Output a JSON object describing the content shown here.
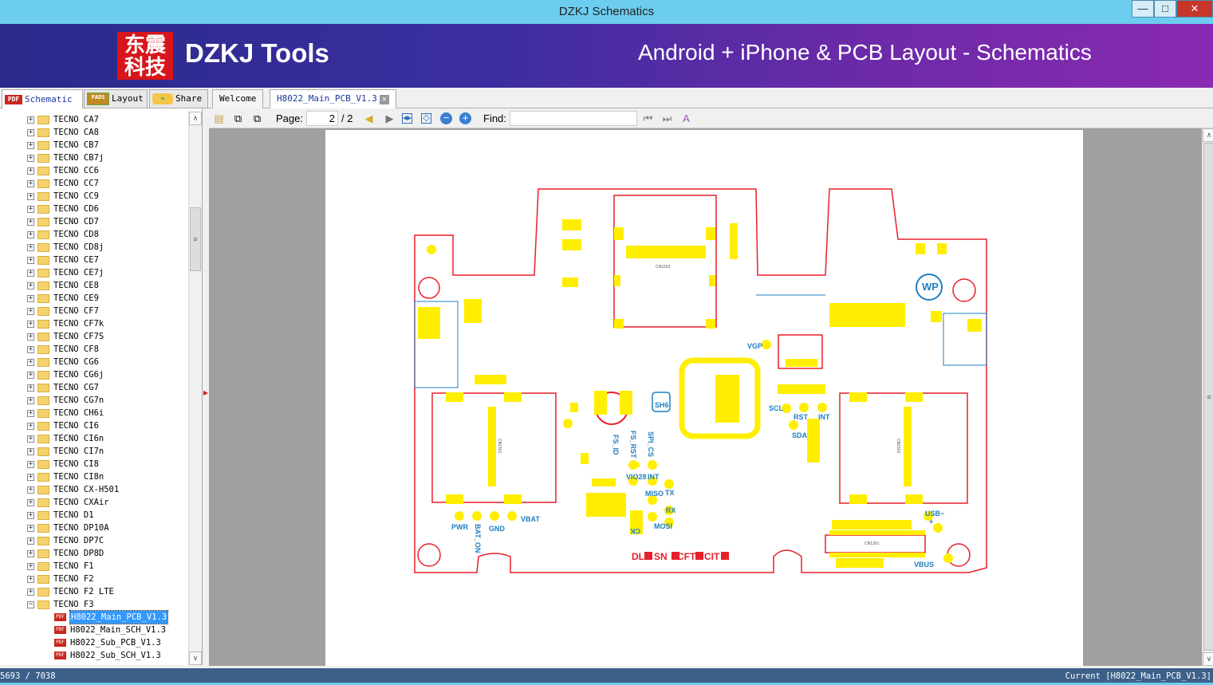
{
  "window": {
    "title": "DZKJ Schematics",
    "minimize": "—",
    "maximize": "□",
    "close": "✕"
  },
  "banner": {
    "logo_text": "东震科技",
    "brand": "DZKJ Tools",
    "tagline": "Android + iPhone & PCB Layout - Schematics"
  },
  "left_tabs": [
    {
      "label": "Schematic",
      "icon": "PDF"
    },
    {
      "label": "Layout",
      "icon": "PADS"
    },
    {
      "label": "Share",
      "icon": "cloud-plus"
    }
  ],
  "doc_tabs": [
    {
      "label": "Welcome"
    },
    {
      "label": "H8022_Main_PCB_V1.3"
    }
  ],
  "tree": {
    "folders": [
      "TECNO CA7",
      "TECNO CA8",
      "TECNO CB7",
      "TECNO CB7j",
      "TECNO CC6",
      "TECNO CC7",
      "TECNO CC9",
      "TECNO CD6",
      "TECNO CD7",
      "TECNO CD8",
      "TECNO CD8j",
      "TECNO CE7",
      "TECNO CE7j",
      "TECNO CE8",
      "TECNO CE9",
      "TECNO CF7",
      "TECNO CF7k",
      "TECNO CF7S",
      "TECNO CF8",
      "TECNO CG6",
      "TECNO CG6j",
      "TECNO CG7",
      "TECNO CG7n",
      "TECNO CH6i",
      "TECNO CI6",
      "TECNO CI6n",
      "TECNO CI7n",
      "TECNO CI8",
      "TECNO CI8n",
      "TECNO CX-H501",
      "TECNO CXAir",
      "TECNO D1",
      "TECNO DP10A",
      "TECNO DP7C",
      "TECNO DP8D",
      "TECNO F1",
      "TECNO F2",
      "TECNO F2 LTE",
      "TECNO F3"
    ],
    "files": [
      "H8022_Main_PCB_V1.3",
      "H8022_Main_SCH_V1.3",
      "H8022_Sub_PCB_V1.3",
      "H8022_Sub_SCH_V1.3"
    ],
    "selected": "H8022_Main_PCB_V1.3"
  },
  "toolbar": {
    "page_label": "Page:",
    "page_value": "2",
    "page_total": "/ 2",
    "find_label": "Find:",
    "find_value": ""
  },
  "pcb": {
    "labels": {
      "vgp": "VGP",
      "scl": "SCL",
      "rst": "RST",
      "int1": "INT",
      "sda": "SDA",
      "fs_id": "FS_ID",
      "fs_rst": "FS_RST",
      "spi_cs": "SPI_CS",
      "vio28": "VIO28",
      "int2": "INT",
      "miso": "MISO",
      "tx": "TX",
      "rx": "RX",
      "mosi": "MOSI",
      "ck": "CK",
      "pwr": "PWR",
      "bat_on": "BAT_ON",
      "gnd": "GND",
      "vbat": "VBAT",
      "usb": "USB",
      "minus": "−",
      "plus": "+",
      "vbus": "VBUS",
      "wp": "WP",
      "sh6": "SH6",
      "cn1503": "CN1503",
      "cn1501": "CN1501",
      "cn1502": "CN1502",
      "cn1301": "CN1301",
      "dl": "DL",
      "sn": "SN",
      "cft": "CFT",
      "cit": "CIT"
    }
  },
  "status": {
    "count": "5693 / 7038",
    "current": "Current [H8022_Main_PCB_V1.3]"
  },
  "colors": {
    "title_bar": "#6ccdf0",
    "status_bar": "#3c6089",
    "pcb_outline": "#e8202a",
    "pcb_pad": "#ffee00",
    "pcb_label": "#1f7fc0"
  }
}
